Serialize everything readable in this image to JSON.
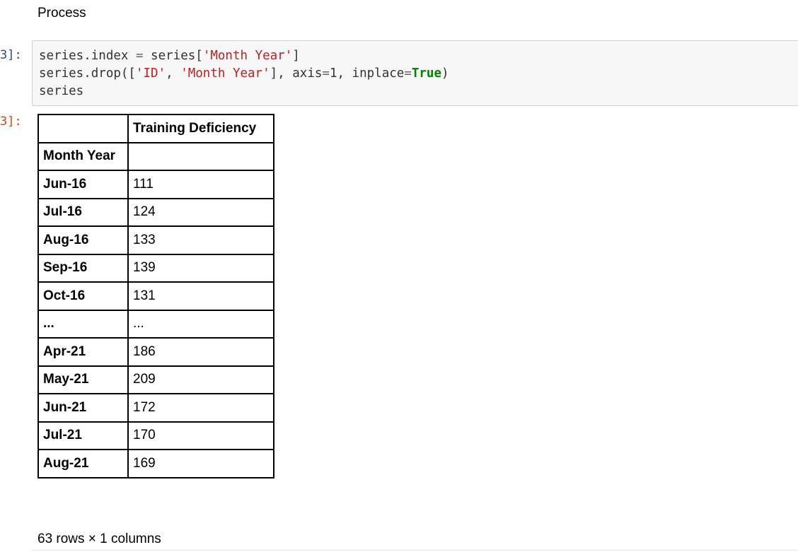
{
  "markdown": {
    "text": "Process"
  },
  "input_prompt": "3]:",
  "output_prompt": "3]:",
  "code": {
    "line1": {
      "a": "series.index ",
      "b": "=",
      "c": " series[",
      "d": "'Month Year'",
      "e": "]"
    },
    "line2": {
      "a": "series.drop([",
      "b": "'ID'",
      "c": ", ",
      "d": "'Month Year'",
      "e": "], axis",
      "f": "=",
      "g": "1, inplace",
      "h": "=",
      "i": "True",
      "j": ")"
    },
    "line3": "series"
  },
  "dataframe": {
    "column_header": "Training Deficiency",
    "index_name": "Month Year",
    "rows": [
      {
        "index": "Jun-16",
        "value": "111"
      },
      {
        "index": "Jul-16",
        "value": "124"
      },
      {
        "index": "Aug-16",
        "value": "133"
      },
      {
        "index": "Sep-16",
        "value": "139"
      },
      {
        "index": "Oct-16",
        "value": "131"
      },
      {
        "index": "...",
        "value": "..."
      },
      {
        "index": "Apr-21",
        "value": "186"
      },
      {
        "index": "May-21",
        "value": "209"
      },
      {
        "index": "Jun-21",
        "value": "172"
      },
      {
        "index": "Jul-21",
        "value": "170"
      },
      {
        "index": "Aug-21",
        "value": "169"
      }
    ],
    "shape_text": "63 rows × 1 columns"
  },
  "colors": {
    "string": "#ba2121",
    "keyword": "#008000",
    "input_prompt": "#303f9f",
    "output_prompt": "#d84315",
    "cell_background": "#f7f7f7"
  }
}
